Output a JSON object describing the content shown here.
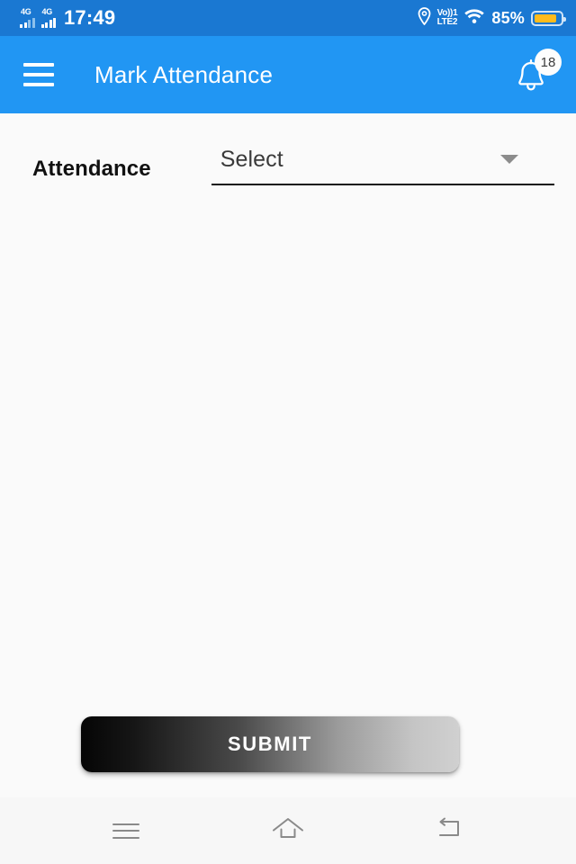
{
  "status_bar": {
    "sim1_network": "4G",
    "sim2_network": "4G",
    "time": "17:49",
    "volte_top": "Vo))1",
    "volte_bottom": "LTE2",
    "battery_percent": "85%",
    "battery_level": 85,
    "background_color": "#1a78d2",
    "battery_fill_color": "#ffbb1c",
    "icons": {
      "location": "location-pin-icon",
      "wifi": "wifi-icon",
      "battery": "battery-icon"
    }
  },
  "app_bar": {
    "title": "Mark Attendance",
    "menu_icon": "hamburger-menu-icon",
    "notification_icon": "bell-icon",
    "notification_count": "18",
    "background_color": "#2196f3",
    "text_color": "#ffffff"
  },
  "form": {
    "attendance": {
      "label": "Attendance",
      "selected_value": "Select",
      "dropdown_icon": "chevron-down-icon"
    }
  },
  "actions": {
    "submit_label": "SUBMIT"
  },
  "nav_bar": {
    "recents_icon": "recents-icon",
    "home_icon": "home-icon",
    "back_icon": "back-icon",
    "background_color": "#f7f7f7"
  }
}
